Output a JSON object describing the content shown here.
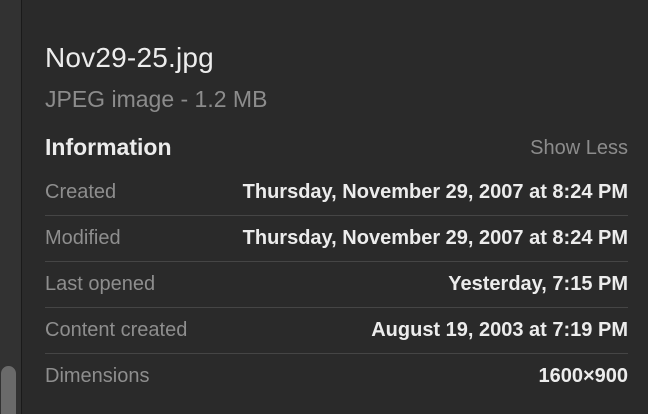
{
  "file": {
    "name": "Nov29-25.jpg",
    "kind": "JPEG image - 1.2 MB"
  },
  "section": {
    "title": "Information",
    "toggle_label": "Show Less"
  },
  "info": [
    {
      "label": "Created",
      "value": "Thursday, November 29, 2007 at 8:24 PM"
    },
    {
      "label": "Modified",
      "value": "Thursday, November 29, 2007 at 8:24 PM"
    },
    {
      "label": "Last opened",
      "value": "Yesterday, 7:15 PM"
    },
    {
      "label": "Content created",
      "value": "August 19, 2003 at 7:19 PM"
    },
    {
      "label": "Dimensions",
      "value": "1600×900"
    }
  ]
}
